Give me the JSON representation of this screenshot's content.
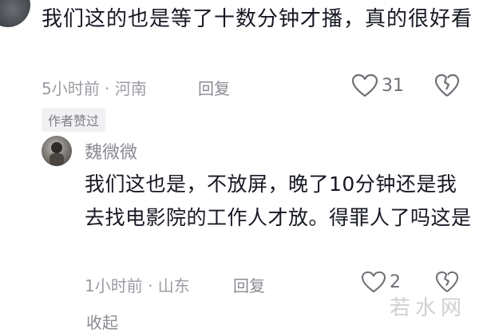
{
  "comment": {
    "text": "我们这的也是等了十数分钟才播，真的很好看",
    "time_location": "5小时前 · 河南",
    "reply_label": "回复",
    "like_count": "31",
    "author_badge": "作者赞过"
  },
  "reply": {
    "username": "魏微微",
    "text": "我们这也是，不放屏，晚了10分钟还是我去找电影院的工作人才放。得罪人了吗这是",
    "time_location": "1小时前 · 山东",
    "reply_label": "回复",
    "like_count": "2"
  },
  "collapse_label": "收起",
  "watermark": "若水网",
  "colors": {
    "text_primary": "#161823",
    "text_secondary": "#9a9ca3",
    "badge_bg": "#f1f1f3"
  },
  "icons": [
    "heart-outline-icon",
    "broken-heart-icon"
  ]
}
